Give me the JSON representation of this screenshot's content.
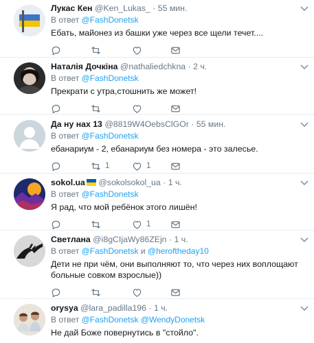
{
  "reply_prefix": "В ответ",
  "tweets": [
    {
      "name": "Лукас Кен",
      "handle": "@Ken_Lukas_",
      "time": "55 мин.",
      "reply_to": [
        "@FashDonetsk"
      ],
      "text": "Ебать, майонез из башки уже через все щели течет....",
      "retweets": "",
      "likes": "",
      "avatar": "flag-avatar"
    },
    {
      "name": "Наталія Дочкіна",
      "handle": "@nathaliedchkna",
      "time": "2 ч.",
      "reply_to": [
        "@FashDonetsk"
      ],
      "text": "Прекрати с утра,стошнить же может!",
      "retweets": "",
      "likes": "",
      "avatar": "photo-avatar"
    },
    {
      "name": "Да ну нах 13",
      "handle": "@8819W4OebsClGOr",
      "time": "55 мин.",
      "reply_to": [
        "@FashDonetsk"
      ],
      "text": "ебанариум - 2, ебанариум без номера - это залесье.",
      "retweets": "1",
      "likes": "1",
      "avatar": "default-avatar"
    },
    {
      "name": "sokol.ua",
      "handle": "@sokolsokol_ua",
      "time": "1 ч.",
      "reply_to": [
        "@FashDonetsk"
      ],
      "text": "Я рад, что мой ребёнок этого лишён!",
      "retweets": "",
      "likes": "1",
      "avatar": "art-avatar",
      "flag": "ukraine-flag"
    },
    {
      "name": "Светлана",
      "handle": "@i8gCIjaWy86ZEjn",
      "time": "1 ч.",
      "reply_to": [
        "@FashDonetsk",
        "@heroftheday10"
      ],
      "and": "и",
      "text": "Дети не при чём, они выполняют то, что через них воплощают больные совком взрослые))",
      "retweets": "",
      "likes": "",
      "avatar": "hands-avatar"
    },
    {
      "name": "orysya",
      "handle": "@lara_padilla196",
      "time": "1 ч.",
      "reply_to": [
        "@FashDonetsk",
        "@WendyDonetsk"
      ],
      "text": "Не дай Боже повернутись в \"стойло\".",
      "retweets": "",
      "likes": "",
      "avatar": "kids-avatar"
    }
  ]
}
